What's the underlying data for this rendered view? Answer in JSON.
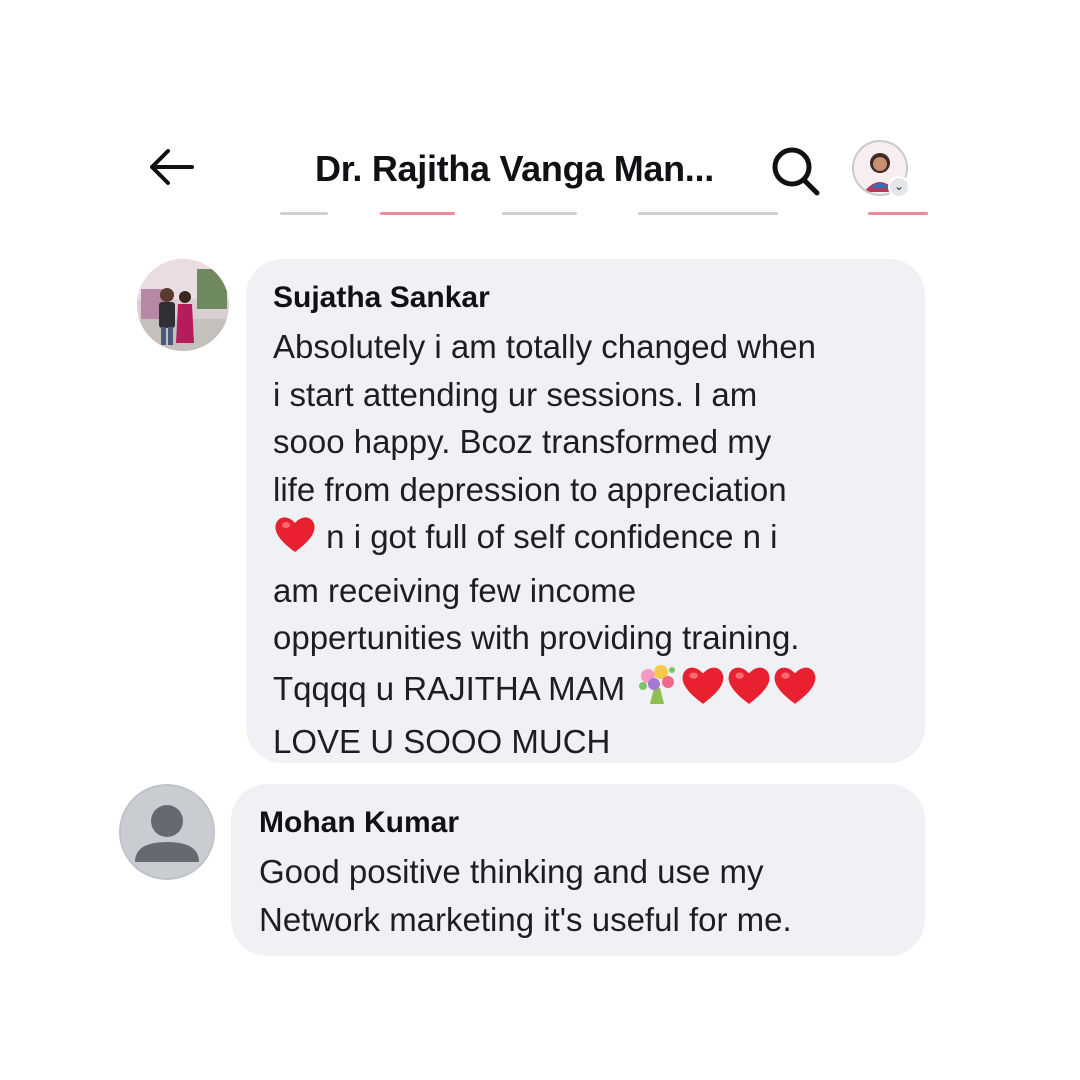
{
  "header": {
    "title": "Dr. Rajitha Vanga Man...",
    "icons": {
      "back": "back-arrow-icon",
      "search": "search-icon",
      "page_avatar": "page-avatar"
    }
  },
  "comments": [
    {
      "author": "Sujatha Sankar",
      "lines": [
        "Absolutely i am totally changed when",
        "i start attending ur sessions. I am",
        "sooo happy. Bcoz transformed my",
        "life from depression to appreciation",
        " n i got full of self confidence n i",
        "am receiving few income",
        "oppertunities with providing training.",
        "Tqqqq u RAJITHA MAM ",
        "LOVE U SOOO MUCH"
      ]
    },
    {
      "author": "Mohan Kumar",
      "lines": [
        "Good positive thinking and use my",
        "Network marketing it's useful for me."
      ]
    }
  ],
  "colors": {
    "bubble": "#eff1f5",
    "text": "#1c1e21",
    "heart": "#e8202f"
  }
}
